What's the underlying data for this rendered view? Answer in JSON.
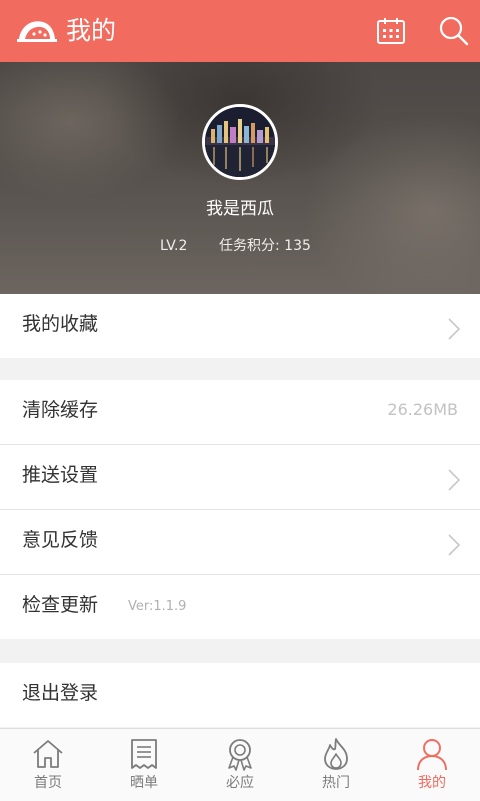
{
  "appbar": {
    "title": "我的",
    "logo": "watermelon-logo",
    "actions": [
      "calendar-icon",
      "search-icon"
    ]
  },
  "profile": {
    "username": "我是西瓜",
    "level": "LV.2",
    "points": "任务积分: 135"
  },
  "settings": {
    "favorites": "我的收藏",
    "clear_cache": "清除缓存",
    "cache_size": "26.26MB",
    "push_settings": "推送设置",
    "feedback": "意见反馈",
    "check_update": "检查更新",
    "version": "Ver:1.1.9",
    "logout": "退出登录"
  },
  "tabs": {
    "home": "首页",
    "share": "晒单",
    "must": "必应",
    "hot": "热门",
    "mine": "我的"
  },
  "colors": {
    "accent": "#f16b5e",
    "tab_inactive": "#7c7c7c",
    "background": "#f2f2f2"
  }
}
